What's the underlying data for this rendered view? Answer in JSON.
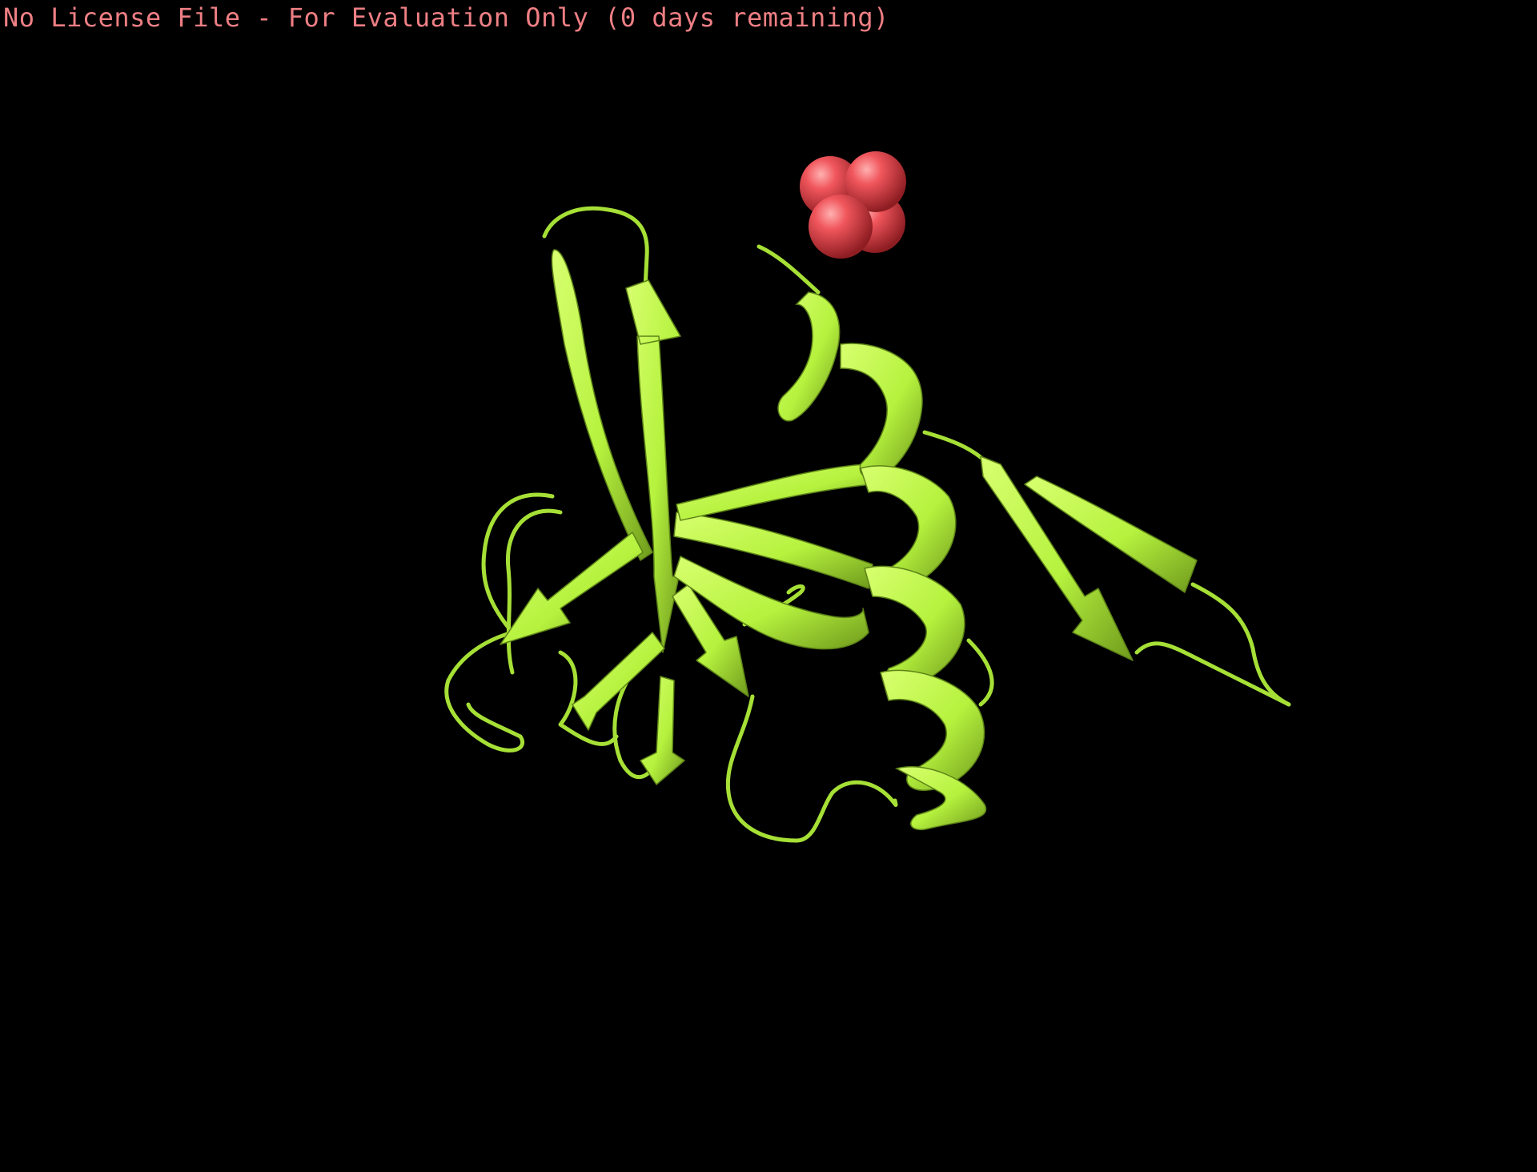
{
  "viewer": {
    "background_color": "#000000",
    "banner_text": "No License File - For Evaluation Only (0 days remaining)",
    "banner_color": "#ee7f84"
  },
  "molecule": {
    "representation": "cartoon",
    "cartoon_color": "#b6f23e",
    "ligand": {
      "representation": "spheres",
      "oxygen_color": "#e8424a",
      "phosphorus_color": "#ff8c1a"
    }
  }
}
